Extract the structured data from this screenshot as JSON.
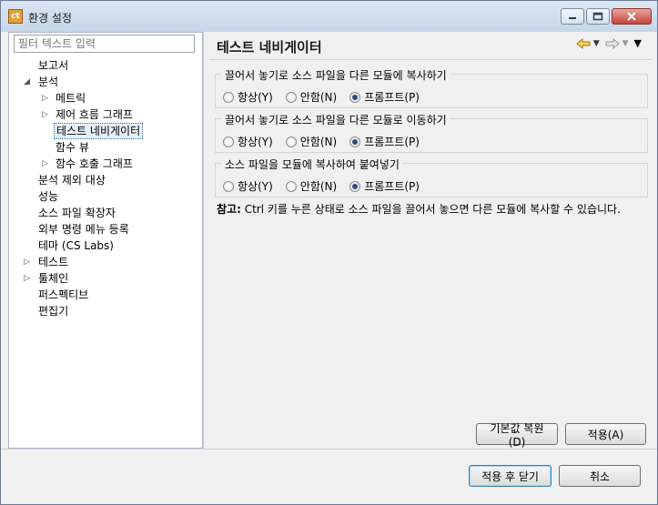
{
  "window": {
    "title": "환경 설정",
    "icon_text": "ct",
    "controls": {
      "minimize": "minimize-icon",
      "maximize": "maximize-icon",
      "close": "close-icon"
    }
  },
  "sidebar": {
    "filter_placeholder": "필터 텍스트 입력",
    "items": [
      {
        "label": "보고서",
        "level": 0,
        "twisty": ""
      },
      {
        "label": "분석",
        "level": 0,
        "twisty": "expanded"
      },
      {
        "label": "메트릭",
        "level": 1,
        "twisty": "collapsed"
      },
      {
        "label": "제어 흐름 그래프",
        "level": 1,
        "twisty": "collapsed"
      },
      {
        "label": "테스트 네비게이터",
        "level": 1,
        "twisty": "",
        "selected": true
      },
      {
        "label": "함수 뷰",
        "level": 1,
        "twisty": ""
      },
      {
        "label": "함수 호출 그래프",
        "level": 1,
        "twisty": "collapsed"
      },
      {
        "label": "분석 제외 대상",
        "level": 0,
        "twisty": ""
      },
      {
        "label": "성능",
        "level": 0,
        "twisty": ""
      },
      {
        "label": "소스 파일 확장자",
        "level": 0,
        "twisty": ""
      },
      {
        "label": "외부 명령 메뉴 등록",
        "level": 0,
        "twisty": ""
      },
      {
        "label": "테마 (CS Labs)",
        "level": 0,
        "twisty": ""
      },
      {
        "label": "테스트",
        "level": 0,
        "twisty": "collapsed"
      },
      {
        "label": "툴체인",
        "level": 0,
        "twisty": "collapsed"
      },
      {
        "label": "퍼스펙티브",
        "level": 0,
        "twisty": ""
      },
      {
        "label": "편집기",
        "level": 0,
        "twisty": ""
      }
    ]
  },
  "main": {
    "title": "테스트 네비게이터",
    "nav": {
      "back_icon": "back-arrow-icon",
      "forward_icon": "forward-arrow-icon",
      "menu_icon": "view-menu-icon"
    },
    "groups": [
      {
        "title": "끌어서 놓기로 소스 파일을 다른 모듈에 복사하기",
        "options": [
          "항상(Y)",
          "안함(N)",
          "프롬프트(P)"
        ],
        "selected": "프롬프트(P)"
      },
      {
        "title": "끌어서 놓기로 소스 파일을 다른 모듈로 이동하기",
        "options": [
          "항상(Y)",
          "안함(N)",
          "프롬프트(P)"
        ],
        "selected": "프롬프트(P)"
      },
      {
        "title": "소스 파일을 모듈에 복사하여 붙여넣기",
        "options": [
          "항상(Y)",
          "안함(N)",
          "프롬프트(P)"
        ],
        "selected": "프롬프트(P)"
      }
    ],
    "note_label": "참고:",
    "note_text": " Ctrl 키를 누른 상태로 소스 파일을 끌어서 놓으면 다른 모듈에 복사할 수 있습니다.",
    "restore_defaults_label": "기본값 복원(D)",
    "apply_label": "적용(A)"
  },
  "footer": {
    "apply_close_label": "적용 후 닫기",
    "cancel_label": "취소"
  }
}
